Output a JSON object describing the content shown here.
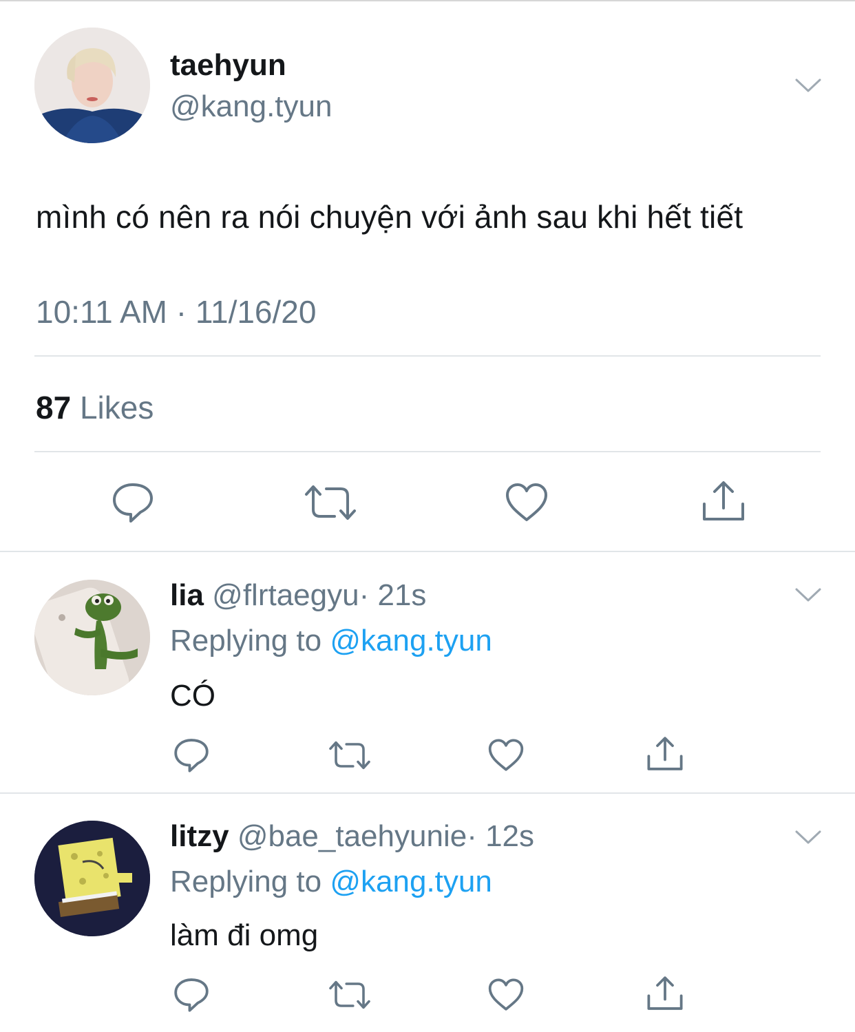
{
  "main_tweet": {
    "name": "taehyun",
    "handle": "@kang.tyun",
    "text": "mình có nên ra nói chuyện với ảnh sau khi hết tiết",
    "timestamp": "10:11 AM · 11/16/20",
    "likes_count": "87",
    "likes_label": "Likes"
  },
  "replies": [
    {
      "name": "lia",
      "handle": "@flrtaegyu",
      "time": "· 21s",
      "replying_label": "Replying to",
      "replying_to": "@kang.tyun",
      "text": "CÓ"
    },
    {
      "name": "litzy",
      "handle": "@bae_taehyunie",
      "time": "· 12s",
      "replying_label": "Replying to",
      "replying_to": "@kang.tyun",
      "text": "làm đi omg"
    }
  ],
  "icons": [
    "reply-icon",
    "retweet-icon",
    "like-icon",
    "share-icon",
    "chevron-down-icon"
  ],
  "colors": {
    "text": "#14171a",
    "secondary": "#657786",
    "link": "#1da1f2",
    "divider": "#e1e5e8"
  }
}
